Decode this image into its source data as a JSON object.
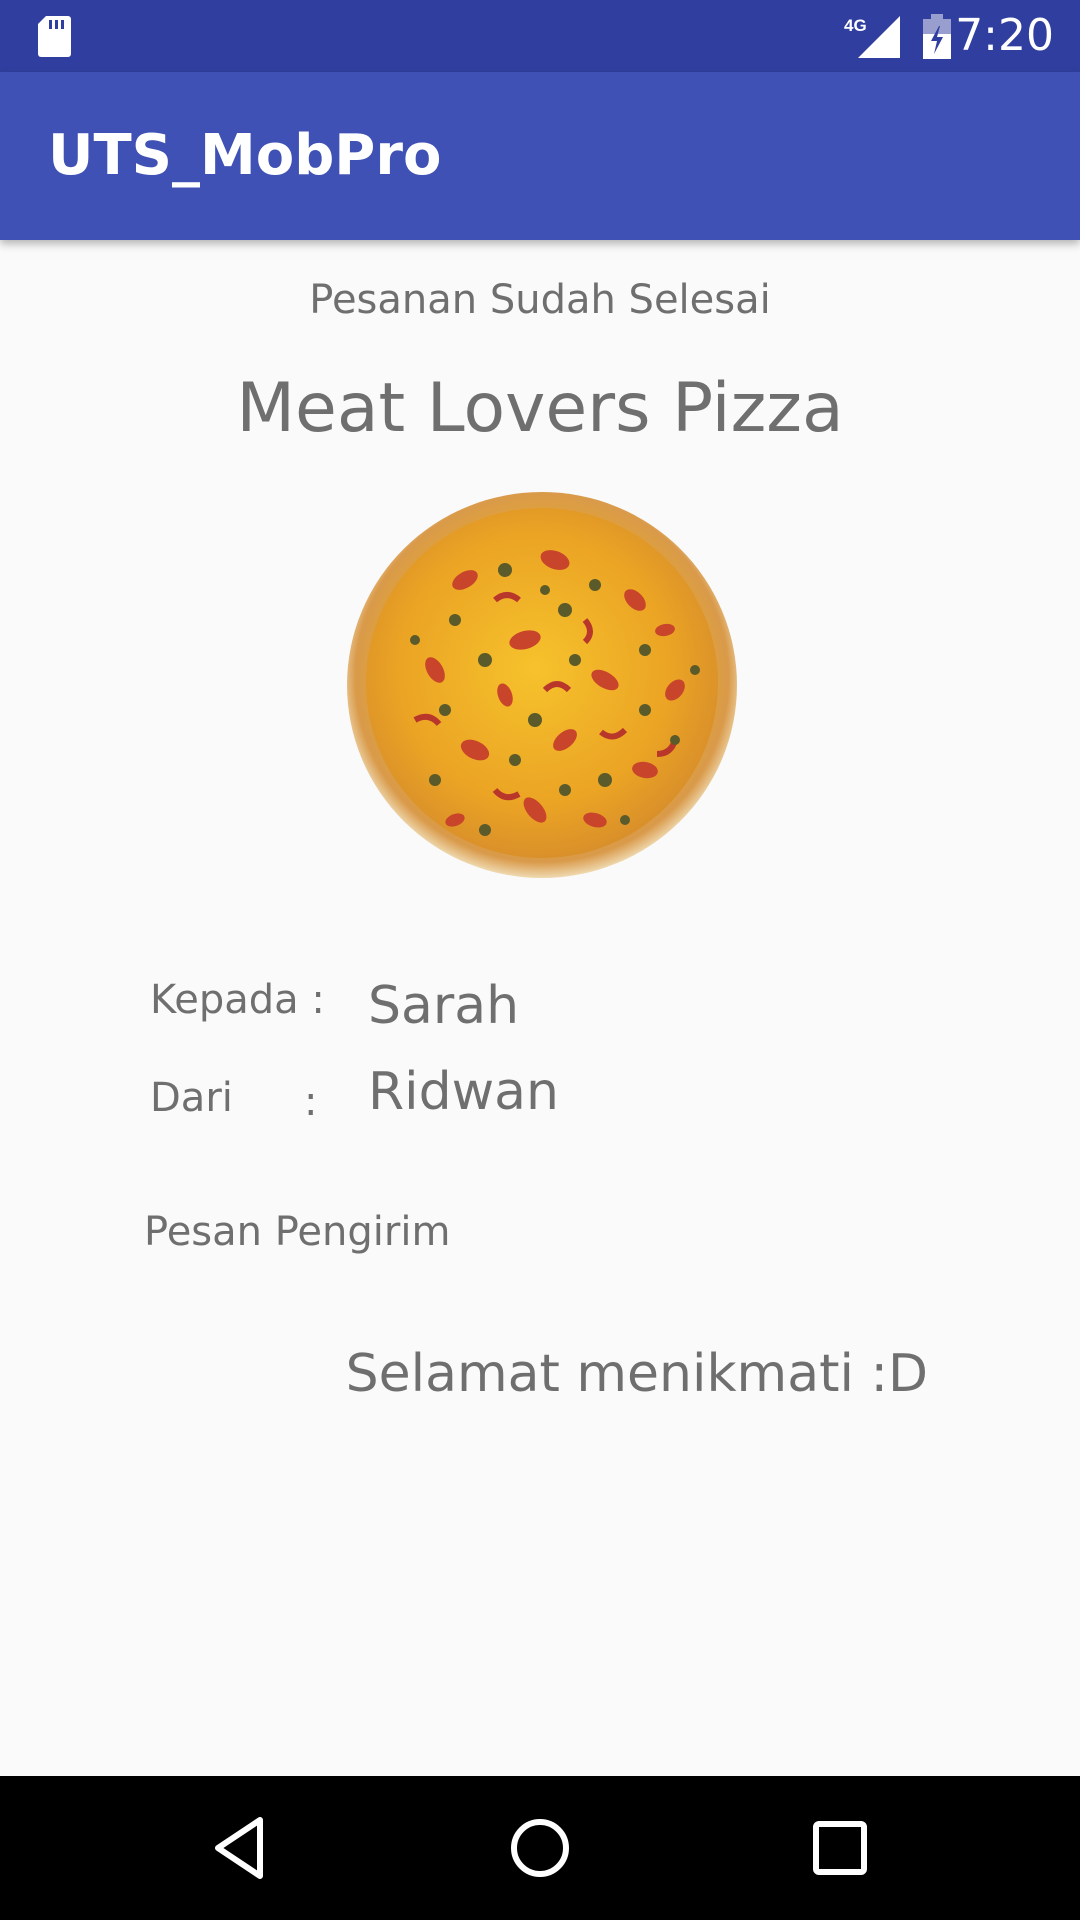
{
  "status_bar": {
    "time": "7:20",
    "network_label": "4G",
    "icons": [
      "sd-card-icon",
      "signal-4g-icon",
      "battery-charging-icon"
    ],
    "background": "#303F9F"
  },
  "app_bar": {
    "title": "UTS_MobPro",
    "background": "#3F51B5"
  },
  "order": {
    "status": "Pesanan Sudah Selesai",
    "item_name": "Meat Lovers Pizza",
    "image_icon": "pizza-image",
    "recipient_label": "Kepada :",
    "recipient": "Sarah",
    "sender_label": "Dari",
    "sender_colon": ":",
    "sender": "Ridwan",
    "message_label": "Pesan Pengirim",
    "message": "Selamat menikmati :D"
  },
  "nav_bar": {
    "buttons": [
      "back-icon",
      "home-icon",
      "recents-icon"
    ]
  }
}
